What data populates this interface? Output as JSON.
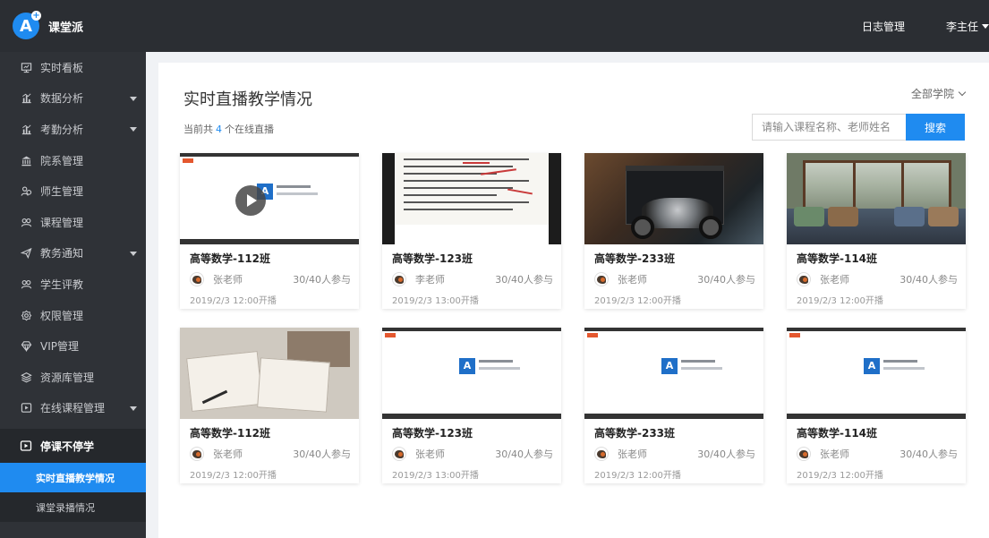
{
  "app": {
    "name": "课堂派"
  },
  "header": {
    "log_link": "日志管理",
    "user_name": "李主任"
  },
  "sidebar": {
    "items": [
      {
        "label": "实时看板",
        "icon": "monitor-icon",
        "has_arrow": false
      },
      {
        "label": "数据分析",
        "icon": "bar-chart-icon",
        "has_arrow": true
      },
      {
        "label": "考勤分析",
        "icon": "bar-chart-icon",
        "has_arrow": true
      },
      {
        "label": "院系管理",
        "icon": "building-icon",
        "has_arrow": false
      },
      {
        "label": "师生管理",
        "icon": "people-icon",
        "has_arrow": false
      },
      {
        "label": "课程管理",
        "icon": "group-icon",
        "has_arrow": false
      },
      {
        "label": "教务通知",
        "icon": "send-icon",
        "has_arrow": true
      },
      {
        "label": "学生评教",
        "icon": "group-icon",
        "has_arrow": false
      },
      {
        "label": "权限管理",
        "icon": "gear-icon",
        "has_arrow": false
      },
      {
        "label": "VIP管理",
        "icon": "diamond-icon",
        "has_arrow": false
      },
      {
        "label": "资源库管理",
        "icon": "layers-icon",
        "has_arrow": false
      },
      {
        "label": "在线课程管理",
        "icon": "play-box-icon",
        "has_arrow": true
      }
    ],
    "group": {
      "label": "停课不停学",
      "sub_items": [
        {
          "label": "实时直播教学情况",
          "active": true
        },
        {
          "label": "课堂录播情况",
          "active": false
        }
      ]
    }
  },
  "main": {
    "title": "实时直播教学情况",
    "college_select": "全部学院",
    "count_prefix": "当前共",
    "count_value": "4",
    "count_suffix": "个在线直播",
    "search": {
      "placeholder": "请输入课程名称、老师姓名",
      "button_label": "搜索"
    },
    "cards": [
      {
        "title": "高等数学-112班",
        "teacher": "张老师",
        "participants": "30/40人参与",
        "start": "2019/2/3 12:00开播",
        "thumb": "slide-play"
      },
      {
        "title": "高等数学-123班",
        "teacher": "李老师",
        "participants": "30/40人参与",
        "start": "2019/2/3 13:00开播",
        "thumb": "document"
      },
      {
        "title": "高等数学-233班",
        "teacher": "张老师",
        "participants": "30/40人参与",
        "start": "2019/2/3 12:00开播",
        "thumb": "motorcycle"
      },
      {
        "title": "高等数学-114班",
        "teacher": "张老师",
        "participants": "30/40人参与",
        "start": "2019/2/3 12:00开播",
        "thumb": "room"
      },
      {
        "title": "高等数学-112班",
        "teacher": "张老师",
        "participants": "30/40人参与",
        "start": "2019/2/3 12:00开播",
        "thumb": "books"
      },
      {
        "title": "高等数学-123班",
        "teacher": "张老师",
        "participants": "30/40人参与",
        "start": "2019/2/3 13:00开播",
        "thumb": "slide"
      },
      {
        "title": "高等数学-233班",
        "teacher": "张老师",
        "participants": "30/40人参与",
        "start": "2019/2/3 12:00开播",
        "thumb": "slide"
      },
      {
        "title": "高等数学-114班",
        "teacher": "张老师",
        "participants": "30/40人参与",
        "start": "2019/2/3 12:00开播",
        "thumb": "slide"
      }
    ]
  },
  "colors": {
    "topbar": "#2b2e33",
    "sidebar": "#2f3237",
    "accent": "#1f8bf0"
  }
}
